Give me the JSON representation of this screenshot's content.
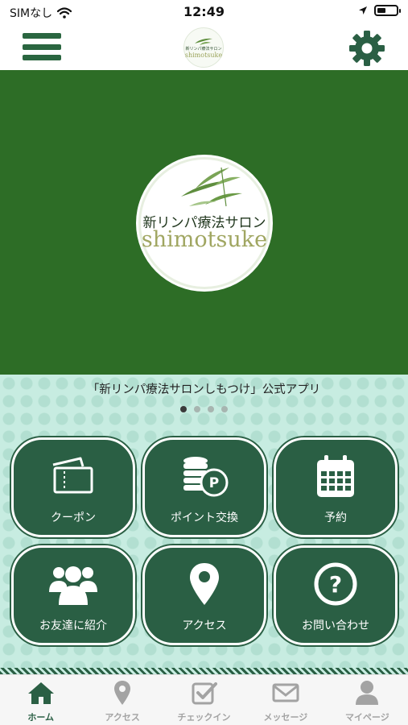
{
  "status_bar": {
    "carrier": "SIMなし",
    "time": "12:49"
  },
  "header": {
    "logo_ja": "新リンパ療法サロン",
    "logo_en": "shimotsuke"
  },
  "hero": {
    "logo_ja": "新リンパ療法サロン",
    "logo_en": "shimotsuke"
  },
  "banner": {
    "caption": "「新リンパ療法サロンしもつけ」公式アプリ",
    "page_count": 4,
    "active_page": 1
  },
  "menu": [
    {
      "label": "クーポン",
      "icon": "ticket-icon"
    },
    {
      "label": "ポイント交換",
      "icon": "coins-icon"
    },
    {
      "label": "予約",
      "icon": "calendar-icon"
    },
    {
      "label": "お友達に紹介",
      "icon": "users-icon"
    },
    {
      "label": "アクセス",
      "icon": "map-pin-icon"
    },
    {
      "label": "お問い合わせ",
      "icon": "question-icon"
    }
  ],
  "tabs": [
    {
      "label": "ホーム",
      "icon": "home-icon",
      "active": true
    },
    {
      "label": "アクセス",
      "icon": "map-pin-icon",
      "active": false
    },
    {
      "label": "チェックイン",
      "icon": "checkbox-icon",
      "active": false
    },
    {
      "label": "メッセージ",
      "icon": "mail-icon",
      "active": false
    },
    {
      "label": "マイページ",
      "icon": "user-icon",
      "active": false
    }
  ],
  "colors": {
    "brand_green": "#2a5f44",
    "hero_green": "#2d6d26",
    "pattern_mint": "#c7ece1",
    "tab_inactive": "#a3a3a3"
  }
}
